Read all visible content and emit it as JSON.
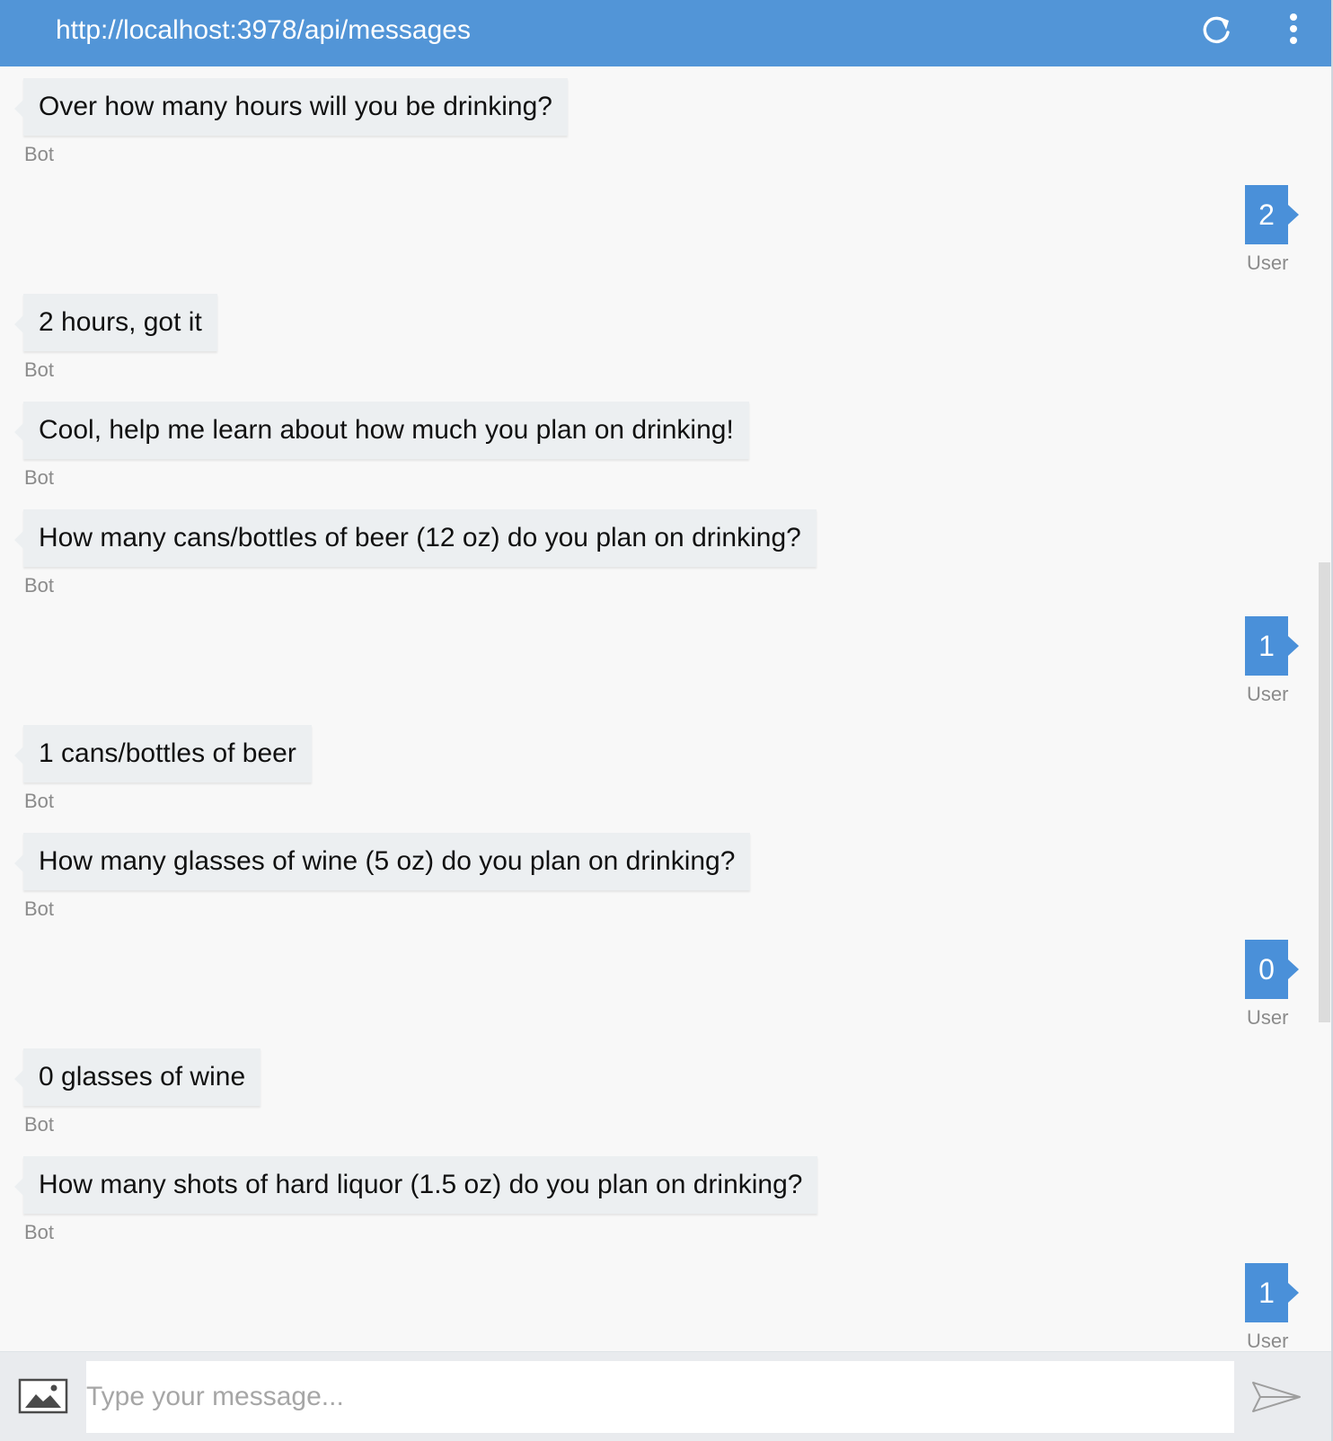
{
  "header": {
    "title": "http://localhost:3978/api/messages",
    "refresh_icon": "refresh-icon",
    "menu_icon": "more-vertical-icon",
    "background": "#5295d7"
  },
  "messages": [
    {
      "from": "bot",
      "text": "Over how many hours will you be drinking?",
      "sender": "Bot"
    },
    {
      "from": "user",
      "text": "2",
      "sender": "User"
    },
    {
      "from": "bot",
      "text": "2 hours, got it",
      "sender": "Bot"
    },
    {
      "from": "bot",
      "text": "Cool, help me learn about how much you plan on drinking!",
      "sender": "Bot"
    },
    {
      "from": "bot",
      "text": "How many cans/bottles of beer (12 oz) do you plan on drinking?",
      "sender": "Bot"
    },
    {
      "from": "user",
      "text": "1",
      "sender": "User"
    },
    {
      "from": "bot",
      "text": "1 cans/bottles of beer",
      "sender": "Bot"
    },
    {
      "from": "bot",
      "text": "How many glasses of wine (5 oz) do you plan on drinking?",
      "sender": "Bot"
    },
    {
      "from": "user",
      "text": "0",
      "sender": "User"
    },
    {
      "from": "bot",
      "text": "0 glasses of wine",
      "sender": "Bot"
    },
    {
      "from": "bot",
      "text": "How many shots of hard liquor (1.5 oz) do you plan on drinking?",
      "sender": "Bot"
    },
    {
      "from": "user",
      "text": "1",
      "sender": "User"
    }
  ],
  "composer": {
    "placeholder": "Type your message...",
    "value": "",
    "upload_icon": "image-upload-icon",
    "send_icon": "send-icon"
  },
  "colors": {
    "user_bubble": "#4a90d9",
    "bot_bubble": "#eceff1",
    "background": "#f8f8f8"
  }
}
